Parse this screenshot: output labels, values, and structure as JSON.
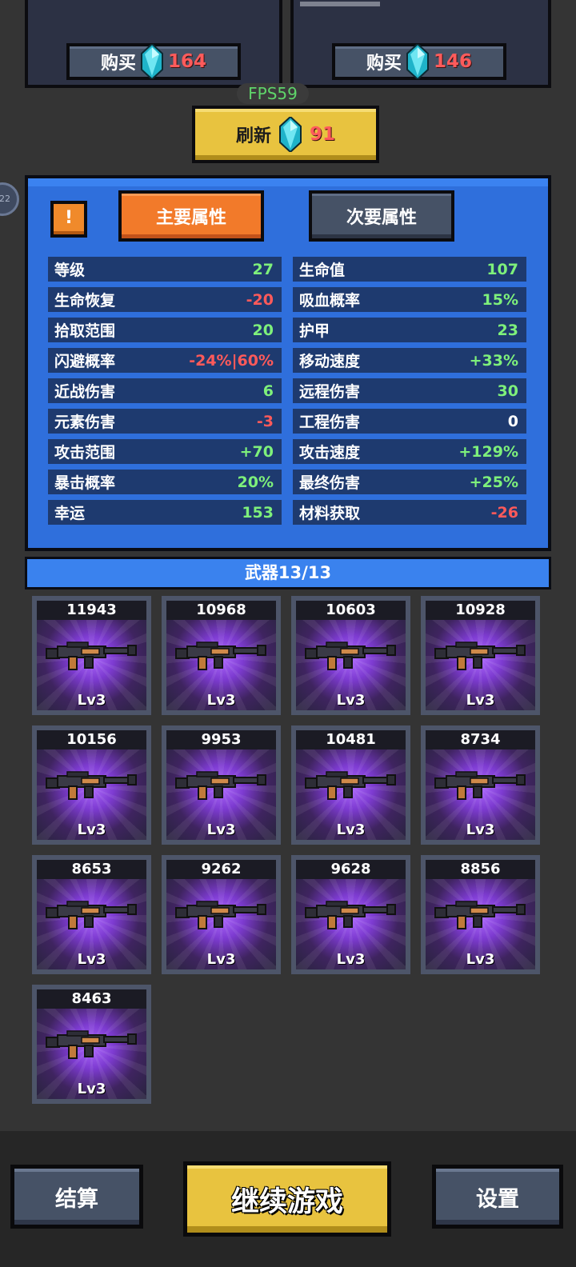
{
  "shop": {
    "left": {
      "buy_label": "购买",
      "price": "164"
    },
    "right": {
      "buy_label": "购买",
      "price": "146"
    }
  },
  "fps": "FPS59",
  "refresh": {
    "label": "刷新",
    "price": "91"
  },
  "side_bubble": "22",
  "tabs": {
    "primary": "主要属性",
    "secondary": "次要属性"
  },
  "warn_label": "!",
  "stats_left": [
    {
      "label": "等级",
      "value": "27",
      "tone": "pos"
    },
    {
      "label": "生命恢复",
      "value": "-20",
      "tone": "neg"
    },
    {
      "label": "拾取范围",
      "value": "20",
      "tone": "pos"
    },
    {
      "label": "闪避概率",
      "value": "-24%|60%",
      "tone": "mix"
    },
    {
      "label": "近战伤害",
      "value": "6",
      "tone": "pos"
    },
    {
      "label": "元素伤害",
      "value": "-3",
      "tone": "neg"
    },
    {
      "label": "攻击范围",
      "value": "+70",
      "tone": "pos"
    },
    {
      "label": "暴击概率",
      "value": "20%",
      "tone": "pos"
    },
    {
      "label": "幸运",
      "value": "153",
      "tone": "pos"
    }
  ],
  "stats_right": [
    {
      "label": "生命值",
      "value": "107",
      "tone": "pos"
    },
    {
      "label": "吸血概率",
      "value": "15%",
      "tone": "pos"
    },
    {
      "label": "护甲",
      "value": "23",
      "tone": "pos"
    },
    {
      "label": "移动速度",
      "value": "+33%",
      "tone": "pos"
    },
    {
      "label": "远程伤害",
      "value": "30",
      "tone": "pos"
    },
    {
      "label": "工程伤害",
      "value": "0",
      "tone": "zero"
    },
    {
      "label": "攻击速度",
      "value": "+129%",
      "tone": "pos"
    },
    {
      "label": "最终伤害",
      "value": "+25%",
      "tone": "pos"
    },
    {
      "label": "材料获取",
      "value": "-26",
      "tone": "neg"
    }
  ],
  "weapons": {
    "title": "武器13/13",
    "items": [
      {
        "price": "11943",
        "level": "Lv3",
        "icon": "rifle-icon"
      },
      {
        "price": "10968",
        "level": "Lv3",
        "icon": "rifle-icon"
      },
      {
        "price": "10603",
        "level": "Lv3",
        "icon": "rifle-icon"
      },
      {
        "price": "10928",
        "level": "Lv3",
        "icon": "rifle-icon"
      },
      {
        "price": "10156",
        "level": "Lv3",
        "icon": "rifle-icon"
      },
      {
        "price": "9953",
        "level": "Lv3",
        "icon": "rifle-icon"
      },
      {
        "price": "10481",
        "level": "Lv3",
        "icon": "rifle-icon"
      },
      {
        "price": "8734",
        "level": "Lv3",
        "icon": "rifle-icon"
      },
      {
        "price": "8653",
        "level": "Lv3",
        "icon": "rifle-icon"
      },
      {
        "price": "9262",
        "level": "Lv3",
        "icon": "rifle-icon"
      },
      {
        "price": "9628",
        "level": "Lv3",
        "icon": "rifle-icon"
      },
      {
        "price": "8856",
        "level": "Lv3",
        "icon": "rifle-icon"
      },
      {
        "price": "8463",
        "level": "Lv3",
        "icon": "rifle-icon"
      }
    ]
  },
  "bottom": {
    "settle": "结算",
    "continue": "继续游戏",
    "settings": "设置"
  },
  "colors": {
    "positive": "#7ef07b",
    "negative": "#ff5a5a",
    "panel_blue": "#2f6fdc",
    "gold": "#e8c33f",
    "orange": "#f27a2a"
  }
}
